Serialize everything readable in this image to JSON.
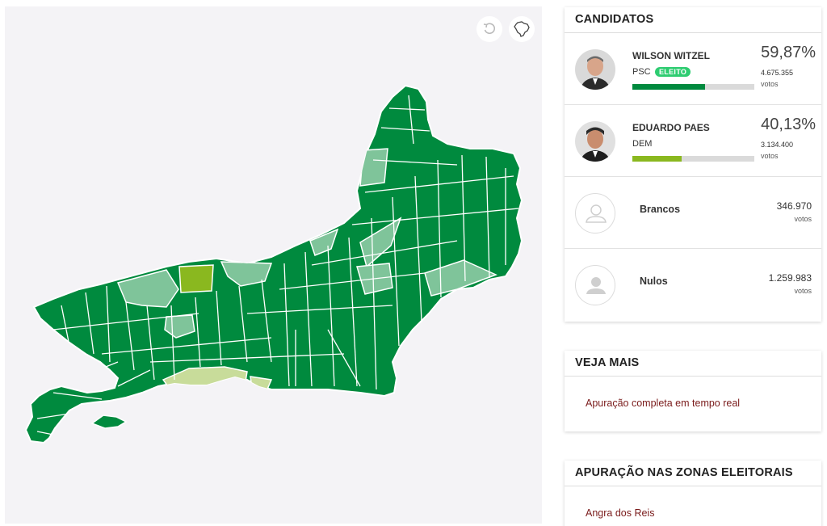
{
  "map": {
    "reset_icon": "undo-icon",
    "brazil_icon": "brazil-map-icon",
    "colors": {
      "witzel_strong": "#008a3e",
      "witzel_light": "#7fc49a",
      "paes_strong": "#8ab81f",
      "paes_light": "#c8dc9a"
    }
  },
  "candidates": {
    "title": "CANDIDATOS",
    "list": [
      {
        "name": "WILSON WITZEL",
        "party": "PSC",
        "badge": "ELEITO",
        "percent": "59,87%",
        "votes": "4.675.355",
        "votes_label": "votos",
        "bar_fraction": 0.5987,
        "bar_color": "#008a3e"
      },
      {
        "name": "EDUARDO PAES",
        "party": "DEM",
        "percent": "40,13%",
        "votes": "3.134.400",
        "votes_label": "votos",
        "bar_fraction": 0.4013,
        "bar_color": "#8ab81f"
      }
    ],
    "others": [
      {
        "name": "Brancos",
        "votes": "346.970",
        "votes_label": "votos"
      },
      {
        "name": "Nulos",
        "votes": "1.259.983",
        "votes_label": "votos"
      }
    ]
  },
  "veja_mais": {
    "title": "VEJA MAIS",
    "link": "Apuração completa em tempo real"
  },
  "zonas": {
    "title": "APURAÇÃO NAS ZONAS ELEITORAIS",
    "first_item": "Angra dos Reis"
  }
}
